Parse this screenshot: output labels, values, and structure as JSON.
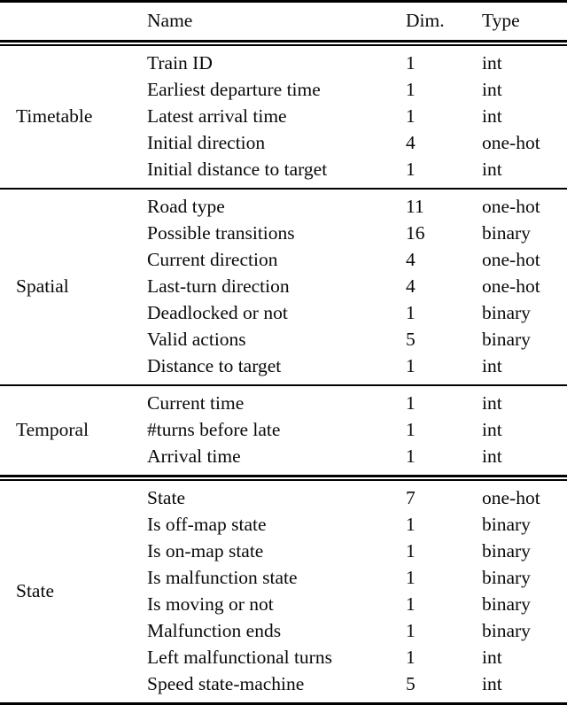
{
  "table": {
    "columns": {
      "group": "",
      "name": "Name",
      "dim": "Dim.",
      "type": "Type"
    },
    "sections": [
      {
        "group": "Timetable",
        "rows": [
          {
            "name": "Train ID",
            "dim": "1",
            "type": "int"
          },
          {
            "name": "Earliest departure time",
            "dim": "1",
            "type": "int"
          },
          {
            "name": "Latest arrival time",
            "dim": "1",
            "type": "int"
          },
          {
            "name": "Initial direction",
            "dim": "4",
            "type": "one-hot"
          },
          {
            "name": "Initial distance to target",
            "dim": "1",
            "type": "int"
          }
        ]
      },
      {
        "group": "Spatial",
        "rows": [
          {
            "name": "Road type",
            "dim": "11",
            "type": "one-hot"
          },
          {
            "name": "Possible transitions",
            "dim": "16",
            "type": "binary"
          },
          {
            "name": "Current direction",
            "dim": "4",
            "type": "one-hot"
          },
          {
            "name": "Last-turn direction",
            "dim": "4",
            "type": "one-hot"
          },
          {
            "name": "Deadlocked or not",
            "dim": "1",
            "type": "binary"
          },
          {
            "name": "Valid actions",
            "dim": "5",
            "type": "binary"
          },
          {
            "name": "Distance to target",
            "dim": "1",
            "type": "int"
          }
        ]
      },
      {
        "group": "Temporal",
        "rows": [
          {
            "name": "Current time",
            "dim": "1",
            "type": "int"
          },
          {
            "name": "#turns before late",
            "dim": "1",
            "type": "int"
          },
          {
            "name": "Arrival time",
            "dim": "1",
            "type": "int"
          }
        ]
      },
      {
        "group": "State",
        "rows": [
          {
            "name": "State",
            "dim": "7",
            "type": "one-hot"
          },
          {
            "name": "Is off-map state",
            "dim": "1",
            "type": "binary"
          },
          {
            "name": "Is on-map state",
            "dim": "1",
            "type": "binary"
          },
          {
            "name": "Is malfunction state",
            "dim": "1",
            "type": "binary"
          },
          {
            "name": "Is moving or not",
            "dim": "1",
            "type": "binary"
          },
          {
            "name": "Malfunction ends",
            "dim": "1",
            "type": "binary"
          },
          {
            "name": "Left malfunctional turns",
            "dim": "1",
            "type": "int"
          },
          {
            "name": "Speed state-machine",
            "dim": "5",
            "type": "int"
          }
        ]
      }
    ],
    "colors": {
      "rule": "#000000",
      "text": "#0a0a0a",
      "background": "#ffffff"
    }
  }
}
